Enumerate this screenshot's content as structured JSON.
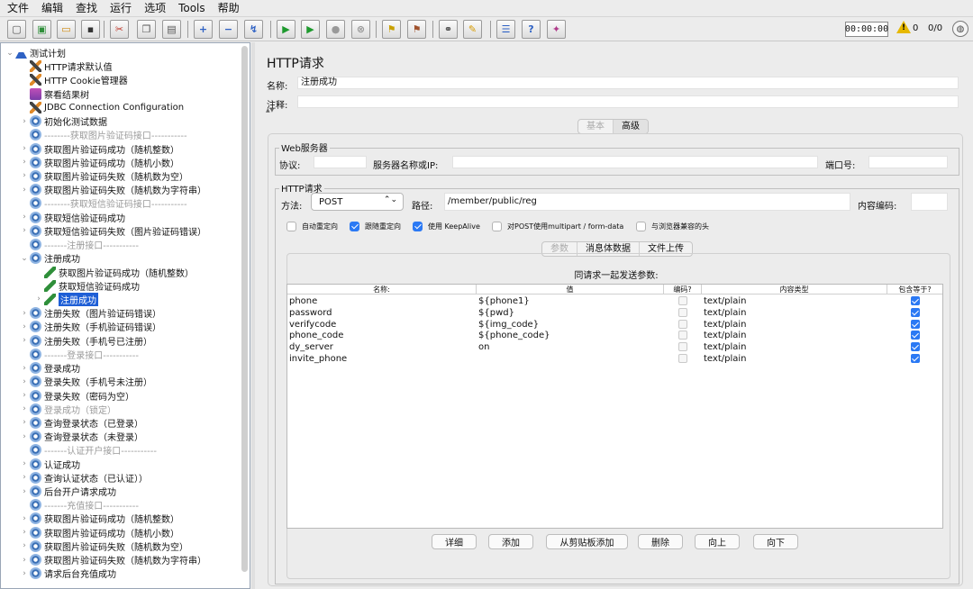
{
  "menu": [
    "文件",
    "编辑",
    "查找",
    "运行",
    "选项",
    "Tools",
    "帮助"
  ],
  "toolbar": {
    "buttons": [
      {
        "name": "new-icon",
        "glyph": "▢",
        "color": "#555"
      },
      {
        "name": "templates-icon",
        "glyph": "▣",
        "color": "#2f8f3a"
      },
      {
        "name": "open-icon",
        "glyph": "▭",
        "color": "#d08a10"
      },
      {
        "name": "save-icon",
        "glyph": "▪",
        "color": "#333"
      },
      {
        "name": "cut-icon",
        "glyph": "✂",
        "color": "#c0392b"
      },
      {
        "name": "copy-icon",
        "glyph": "❐",
        "color": "#555"
      },
      {
        "name": "paste-icon",
        "glyph": "▤",
        "color": "#555"
      },
      {
        "name": "expand-icon",
        "glyph": "+",
        "color": "#2f62c4"
      },
      {
        "name": "collapse-icon",
        "glyph": "−",
        "color": "#2f62c4"
      },
      {
        "name": "toggle-icon",
        "glyph": "↯",
        "color": "#2f62c4"
      },
      {
        "name": "start-icon",
        "glyph": "▶",
        "color": "#1e9a2e"
      },
      {
        "name": "start-no-pause-icon",
        "glyph": "▶",
        "color": "#1e9a2e"
      },
      {
        "name": "stop-icon",
        "glyph": "●",
        "color": "#999"
      },
      {
        "name": "shutdown-icon",
        "glyph": "⊗",
        "color": "#999"
      },
      {
        "name": "clear-icon",
        "glyph": "⚑",
        "color": "#c8a000"
      },
      {
        "name": "clear-all-icon",
        "glyph": "⚑",
        "color": "#a0522d"
      },
      {
        "name": "search-icon",
        "glyph": "⚭",
        "color": "#333"
      },
      {
        "name": "reset-search-icon",
        "glyph": "✎",
        "color": "#d69a00"
      },
      {
        "name": "function-helper-icon",
        "glyph": "☰",
        "color": "#2f62c4"
      },
      {
        "name": "help-icon",
        "glyph": "?",
        "color": "#2f62c4"
      },
      {
        "name": "remote-icon",
        "glyph": "✦",
        "color": "#b03a8a"
      }
    ],
    "timer": "00:00:00",
    "warn_icon": "warning-icon",
    "error_count": "0",
    "thread_ratio": "0/0"
  },
  "tree": [
    {
      "label": "测试计划",
      "icon": "flask",
      "level": 0,
      "chev": "⌄",
      "state": "normal"
    },
    {
      "label": "HTTP请求默认值",
      "icon": "wrench",
      "level": 1,
      "chev": "",
      "state": "normal"
    },
    {
      "label": "HTTP Cookie管理器",
      "icon": "wrench",
      "level": 1,
      "chev": "",
      "state": "normal"
    },
    {
      "label": "察看结果树",
      "icon": "listener",
      "level": 1,
      "chev": "",
      "state": "normal"
    },
    {
      "label": "JDBC Connection Configuration",
      "icon": "wrench",
      "level": 1,
      "chev": "",
      "state": "normal"
    },
    {
      "label": "初始化测试数据",
      "icon": "gear",
      "level": 1,
      "chev": "›",
      "state": "normal"
    },
    {
      "label": "--------获取图片验证码接口-----------",
      "icon": "gear",
      "level": 1,
      "chev": "",
      "state": "disabled"
    },
    {
      "label": "获取图片验证码成功（随机整数）",
      "icon": "gear",
      "level": 1,
      "chev": "›",
      "state": "normal"
    },
    {
      "label": "获取图片验证码成功（随机小数）",
      "icon": "gear",
      "level": 1,
      "chev": "›",
      "state": "normal"
    },
    {
      "label": "获取图片验证码失败（随机数为空）",
      "icon": "gear",
      "level": 1,
      "chev": "›",
      "state": "normal"
    },
    {
      "label": "获取图片验证码失败（随机数为字符串）",
      "icon": "gear",
      "level": 1,
      "chev": "›",
      "state": "normal"
    },
    {
      "label": "--------获取短信验证码接口-----------",
      "icon": "gear",
      "level": 1,
      "chev": "",
      "state": "disabled"
    },
    {
      "label": "获取短信验证码成功",
      "icon": "gear",
      "level": 1,
      "chev": "›",
      "state": "normal"
    },
    {
      "label": "获取短信验证码失败（图片验证码错误）",
      "icon": "gear",
      "level": 1,
      "chev": "›",
      "state": "normal"
    },
    {
      "label": "-------注册接口-----------",
      "icon": "gear",
      "level": 1,
      "chev": "",
      "state": "disabled"
    },
    {
      "label": "注册成功",
      "icon": "gear",
      "level": 1,
      "chev": "⌄",
      "state": "normal"
    },
    {
      "label": "获取图片验证码成功（随机整数）",
      "icon": "sampler",
      "level": 2,
      "chev": "",
      "state": "normal"
    },
    {
      "label": "获取短信验证码成功",
      "icon": "sampler",
      "level": 2,
      "chev": "",
      "state": "normal"
    },
    {
      "label": "注册成功",
      "icon": "sampler",
      "level": 2,
      "chev": "›",
      "state": "selected"
    },
    {
      "label": "注册失败（图片验证码错误）",
      "icon": "gear",
      "level": 1,
      "chev": "›",
      "state": "normal"
    },
    {
      "label": "注册失败（手机验证码错误）",
      "icon": "gear",
      "level": 1,
      "chev": "›",
      "state": "normal"
    },
    {
      "label": "注册失败（手机号已注册）",
      "icon": "gear",
      "level": 1,
      "chev": "›",
      "state": "normal"
    },
    {
      "label": "-------登录接口-----------",
      "icon": "gear",
      "level": 1,
      "chev": "",
      "state": "disabled"
    },
    {
      "label": "登录成功",
      "icon": "gear",
      "level": 1,
      "chev": "›",
      "state": "normal"
    },
    {
      "label": "登录失败（手机号未注册）",
      "icon": "gear",
      "level": 1,
      "chev": "›",
      "state": "normal"
    },
    {
      "label": "登录失败（密码为空）",
      "icon": "gear",
      "level": 1,
      "chev": "›",
      "state": "normal"
    },
    {
      "label": "登录成功（锁定）",
      "icon": "gear",
      "level": 1,
      "chev": "›",
      "state": "disabled"
    },
    {
      "label": "查询登录状态（已登录）",
      "icon": "gear",
      "level": 1,
      "chev": "›",
      "state": "normal"
    },
    {
      "label": "查询登录状态（未登录）",
      "icon": "gear",
      "level": 1,
      "chev": "›",
      "state": "normal"
    },
    {
      "label": "-------认证开户接口-----------",
      "icon": "gear",
      "level": 1,
      "chev": "",
      "state": "disabled"
    },
    {
      "label": "认证成功",
      "icon": "gear",
      "level": 1,
      "chev": "›",
      "state": "normal"
    },
    {
      "label": "查询认证状态（已认证））",
      "icon": "gear",
      "level": 1,
      "chev": "›",
      "state": "normal"
    },
    {
      "label": "后台开户请求成功",
      "icon": "gear",
      "level": 1,
      "chev": "›",
      "state": "normal"
    },
    {
      "label": "-------充值接口-----------",
      "icon": "gear",
      "level": 1,
      "chev": "",
      "state": "disabled"
    },
    {
      "label": "获取图片验证码成功（随机整数）",
      "icon": "gear",
      "level": 1,
      "chev": "›",
      "state": "normal"
    },
    {
      "label": "获取图片验证码成功（随机小数）",
      "icon": "gear",
      "level": 1,
      "chev": "›",
      "state": "normal"
    },
    {
      "label": "获取图片验证码失败（随机数为空）",
      "icon": "gear",
      "level": 1,
      "chev": "›",
      "state": "normal"
    },
    {
      "label": "获取图片验证码失败（随机数为字符串）",
      "icon": "gear",
      "level": 1,
      "chev": "›",
      "state": "normal"
    },
    {
      "label": "请求后台充值成功",
      "icon": "gear",
      "level": 1,
      "chev": "›",
      "state": "normal"
    }
  ],
  "main": {
    "title": "HTTP请求",
    "name_label": "名称:",
    "name_value": "注册成功",
    "comment_label": "注释:",
    "comment_value": "",
    "tabs": [
      "基本",
      "高级"
    ],
    "web": {
      "section": "Web服务器",
      "protocol_label": "协议:",
      "protocol_value": "",
      "server_label": "服务器名称或IP:",
      "server_value": "",
      "port_label": "端口号:",
      "port_value": ""
    },
    "http": {
      "section": "HTTP请求",
      "method_label": "方法:",
      "method_value": "POST",
      "path_label": "路径:",
      "path_value": "/member/public/reg",
      "encoding_label": "内容编码:",
      "encoding_value": ""
    },
    "options": [
      {
        "label": "自动重定向",
        "checked": false
      },
      {
        "label": "跟随重定向",
        "checked": true
      },
      {
        "label": "使用 KeepAlive",
        "checked": true
      },
      {
        "label": "对POST使用multipart / form-data",
        "checked": false
      },
      {
        "label": "与浏览器兼容的头",
        "checked": false
      }
    ],
    "subtabs": [
      "参数",
      "消息体数据",
      "文件上传"
    ],
    "params_caption": "同请求一起发送参数:",
    "columns": [
      "名称:",
      "值",
      "编码?",
      "内容类型",
      "包含等于?"
    ],
    "params": [
      {
        "name": "phone",
        "value": "${phone1}",
        "encode": false,
        "type": "text/plain",
        "equals": true
      },
      {
        "name": "password",
        "value": "${pwd}",
        "encode": false,
        "type": "text/plain",
        "equals": true
      },
      {
        "name": "verifycode",
        "value": "${img_code}",
        "encode": false,
        "type": "text/plain",
        "equals": true
      },
      {
        "name": "phone_code",
        "value": "${phone_code}",
        "encode": false,
        "type": "text/plain",
        "equals": true
      },
      {
        "name": "dy_server",
        "value": "on",
        "encode": false,
        "type": "text/plain",
        "equals": true
      },
      {
        "name": "invite_phone",
        "value": "",
        "encode": false,
        "type": "text/plain",
        "equals": true
      }
    ],
    "buttons": [
      "详细",
      "添加",
      "从剪贴板添加",
      "删除",
      "向上",
      "向下"
    ]
  }
}
